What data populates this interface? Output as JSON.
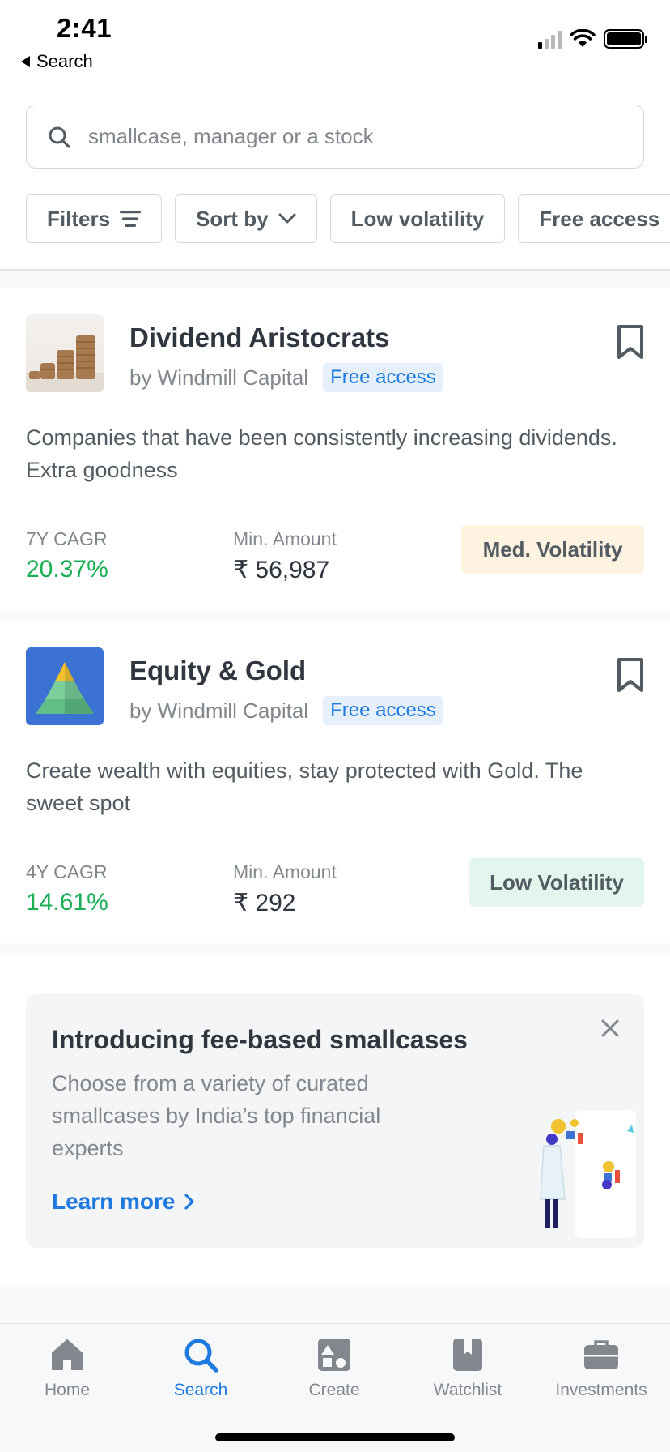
{
  "status_bar": {
    "time": "2:41",
    "back_label": "Search"
  },
  "search": {
    "placeholder": "smallcase, manager or a stock"
  },
  "chips": [
    {
      "label": "Filters",
      "icon": "filter-lines-icon"
    },
    {
      "label": "Sort by",
      "icon": "chevron-down-icon"
    },
    {
      "label": "Low volatility"
    },
    {
      "label": "Free access"
    }
  ],
  "cards": [
    {
      "title": "Dividend Aristocrats",
      "manager": "by Windmill Capital",
      "tag": "Free access",
      "description": "Companies that have been consistently increasing dividends. Extra goodness",
      "cagr_label": "7Y CAGR",
      "cagr_value": "20.37%",
      "amount_label": "Min. Amount",
      "amount_value": "₹ 56,987",
      "volatility": "Med. Volatility",
      "volatility_color": "#fdf3e0",
      "thumb_icon": "coin-stack-image"
    },
    {
      "title": "Equity & Gold",
      "manager": "by Windmill Capital",
      "tag": "Free access",
      "description": "Create wealth with equities, stay protected with Gold. The sweet spot",
      "cagr_label": "4Y CAGR",
      "cagr_value": "14.61%",
      "amount_label": "Min. Amount",
      "amount_value": "₹ 292",
      "volatility": "Low Volatility",
      "volatility_color": "#e3f6ee",
      "thumb_icon": "pyramid-image"
    }
  ],
  "promo": {
    "title": "Introducing fee-based smallcases",
    "text": "Choose from a variety of curated smallcases by India’s top financial experts",
    "link": "Learn more"
  },
  "nav": [
    {
      "label": "Home",
      "icon": "home-icon",
      "active": false
    },
    {
      "label": "Search",
      "icon": "search-icon",
      "active": true
    },
    {
      "label": "Create",
      "icon": "create-icon",
      "active": false
    },
    {
      "label": "Watchlist",
      "icon": "watchlist-icon",
      "active": false
    },
    {
      "label": "Investments",
      "icon": "briefcase-icon",
      "active": false
    }
  ],
  "colors": {
    "accent": "#1f7ae0",
    "positive": "#19af55",
    "text": "#2f363f",
    "muted": "#81878c"
  }
}
